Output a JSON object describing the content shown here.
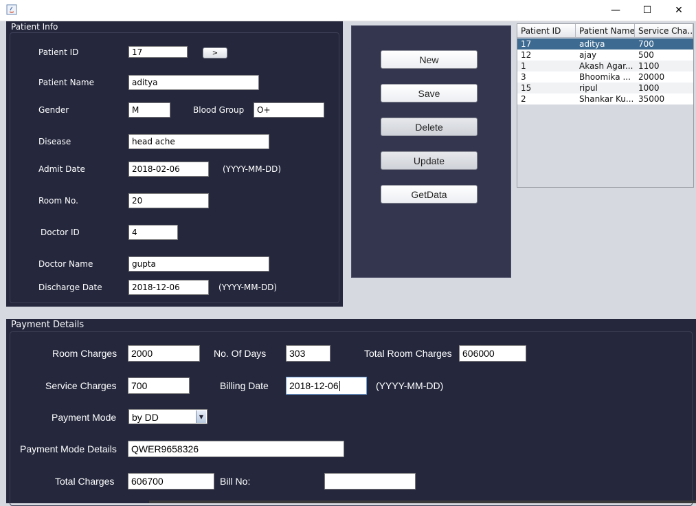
{
  "window": {
    "minimize": "—",
    "maximize": "☐",
    "close": "✕"
  },
  "patient_info": {
    "title": "Patient Info",
    "patient_id_label": "Patient ID",
    "patient_id": "17",
    "lookup_button": ">",
    "patient_name_label": "Patient Name",
    "patient_name": "aditya",
    "gender_label": "Gender",
    "gender": "M",
    "blood_group_label": "Blood Group",
    "blood_group": "O+",
    "disease_label": "Disease",
    "disease": "head ache",
    "admit_date_label": "Admit Date",
    "admit_date": "2018-02-06",
    "admit_date_hint": "(YYYY-MM-DD)",
    "room_no_label": "Room No.",
    "room_no": "20",
    "doctor_id_label": "Doctor ID",
    "doctor_id": "4",
    "doctor_name_label": "Doctor Name",
    "doctor_name": "gupta",
    "discharge_date_label": "Discharge Date",
    "discharge_date": "2018-12-06",
    "discharge_date_hint": "(YYYY-MM-DD)"
  },
  "actions": {
    "new": "New",
    "save": "Save",
    "delete": "Delete",
    "update": "Update",
    "getdata": "GetData"
  },
  "table": {
    "columns": [
      "Patient ID",
      "Patient Name",
      "Service Cha..."
    ],
    "rows": [
      [
        "17",
        "aditya",
        "700"
      ],
      [
        "12",
        "ajay",
        "500"
      ],
      [
        "1",
        "Akash Agar...",
        "1100"
      ],
      [
        "3",
        "Bhoomika ...",
        "20000"
      ],
      [
        "15",
        "ripul",
        "1000"
      ],
      [
        "2",
        "Shankar Ku...",
        "35000"
      ]
    ]
  },
  "payment": {
    "title": "Payment Details",
    "room_charges_label": "Room Charges",
    "room_charges": "2000",
    "no_of_days_label": "No. Of Days",
    "no_of_days": "303",
    "total_room_charges_label": "Total Room Charges",
    "total_room_charges": "606000",
    "service_charges_label": "Service Charges",
    "service_charges": "700",
    "billing_date_label": "Billing Date",
    "billing_date": "2018-12-06",
    "billing_date_hint": "(YYYY-MM-DD)",
    "payment_mode_label": "Payment Mode",
    "payment_mode": "by DD",
    "payment_mode_details_label": "Payment Mode Details",
    "payment_mode_details": "QWER9658326",
    "total_charges_label": "Total Charges",
    "total_charges": "606700",
    "bill_no_label": "Bill No:",
    "bill_no": ""
  }
}
